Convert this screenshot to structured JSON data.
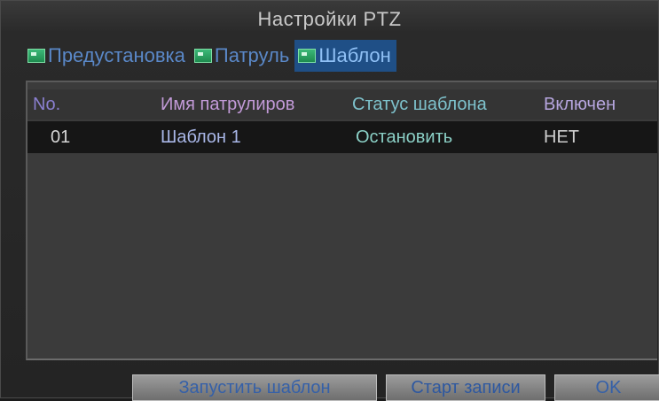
{
  "window": {
    "title": "Настройки PTZ"
  },
  "tabs": [
    {
      "label": "Предустановка",
      "icon": "preset-icon",
      "active": false
    },
    {
      "label": "Патруль",
      "icon": "patrol-icon",
      "active": false
    },
    {
      "label": "Шаблон",
      "icon": "pattern-icon",
      "active": true
    }
  ],
  "table": {
    "headers": [
      "No.",
      "Имя патрулиров",
      "Статус шаблона",
      "Включен"
    ],
    "rows": [
      [
        "01",
        "Шаблон 1",
        "Остановить",
        "НЕТ"
      ]
    ]
  },
  "buttons": {
    "start_pattern": "Запустить шаблон",
    "start_record": "Старт записи",
    "ok": "OK"
  }
}
